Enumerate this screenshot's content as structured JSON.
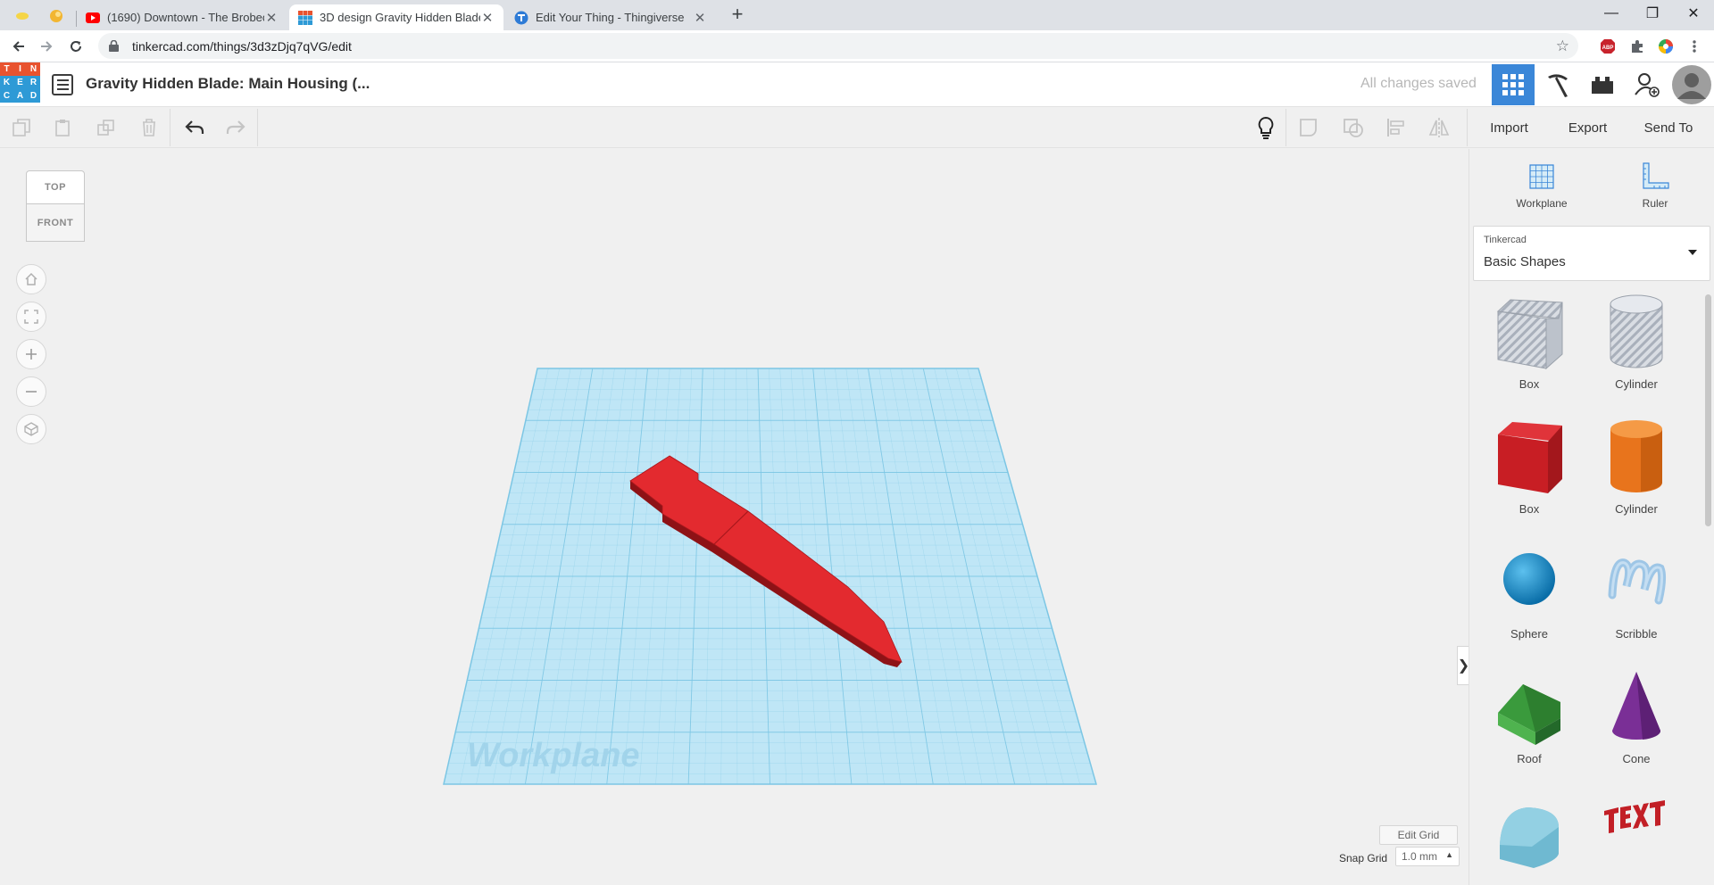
{
  "browser": {
    "tabs": [
      {
        "title": "(1690) Downtown - The Brobecks",
        "favicon": "youtube-icon",
        "active": false
      },
      {
        "title": "3D design Gravity Hidden Blade",
        "favicon": "tinkercad-icon",
        "active": true
      },
      {
        "title": "Edit Your Thing - Thingiverse",
        "favicon": "thingiverse-icon",
        "active": false
      }
    ],
    "new_tab": "+",
    "url": "tinkercad.com/things/3d3zDjq7qVG/edit",
    "window_controls": {
      "minimize": "—",
      "maximize": "❐",
      "close": "✕"
    }
  },
  "header": {
    "logo_letters": [
      "T",
      "I",
      "N",
      "K",
      "E",
      "R",
      "C",
      "A",
      "D"
    ],
    "logo_colors": [
      "#e8532f",
      "#e8532f",
      "#e8532f",
      "#2e9ad6",
      "#2e9ad6",
      "#2e9ad6",
      "#2e9ad6",
      "#2e9ad6",
      "#2e9ad6"
    ],
    "design_title": "Gravity Hidden Blade: Main Housing (...",
    "save_status": "All changes saved"
  },
  "toolbar": {
    "import": "Import",
    "export": "Export",
    "send_to": "Send To"
  },
  "viewcube": {
    "top": "TOP",
    "front": "FRONT"
  },
  "workplane": {
    "label": "Workplane",
    "plane_color": "#bfe6f6",
    "grid_color": "#7cc6e4"
  },
  "model": {
    "color": "#e32a2f"
  },
  "grid_controls": {
    "edit_grid": "Edit Grid",
    "snap_label": "Snap Grid",
    "snap_value": "1.0 mm"
  },
  "panel": {
    "tools": [
      {
        "label": "Workplane",
        "icon": "workplane-icon"
      },
      {
        "label": "Ruler",
        "icon": "ruler-icon"
      }
    ],
    "library": {
      "provider": "Tinkercad",
      "category": "Basic Shapes"
    },
    "shapes": [
      {
        "label": "Box",
        "icon": "hole-box-icon"
      },
      {
        "label": "Cylinder",
        "icon": "hole-cylinder-icon"
      },
      {
        "label": "Box",
        "icon": "box-icon"
      },
      {
        "label": "Cylinder",
        "icon": "cylinder-icon"
      },
      {
        "label": "Sphere",
        "icon": "sphere-icon"
      },
      {
        "label": "Scribble",
        "icon": "scribble-icon"
      },
      {
        "label": "Roof",
        "icon": "roof-icon"
      },
      {
        "label": "Cone",
        "icon": "cone-icon"
      }
    ]
  }
}
